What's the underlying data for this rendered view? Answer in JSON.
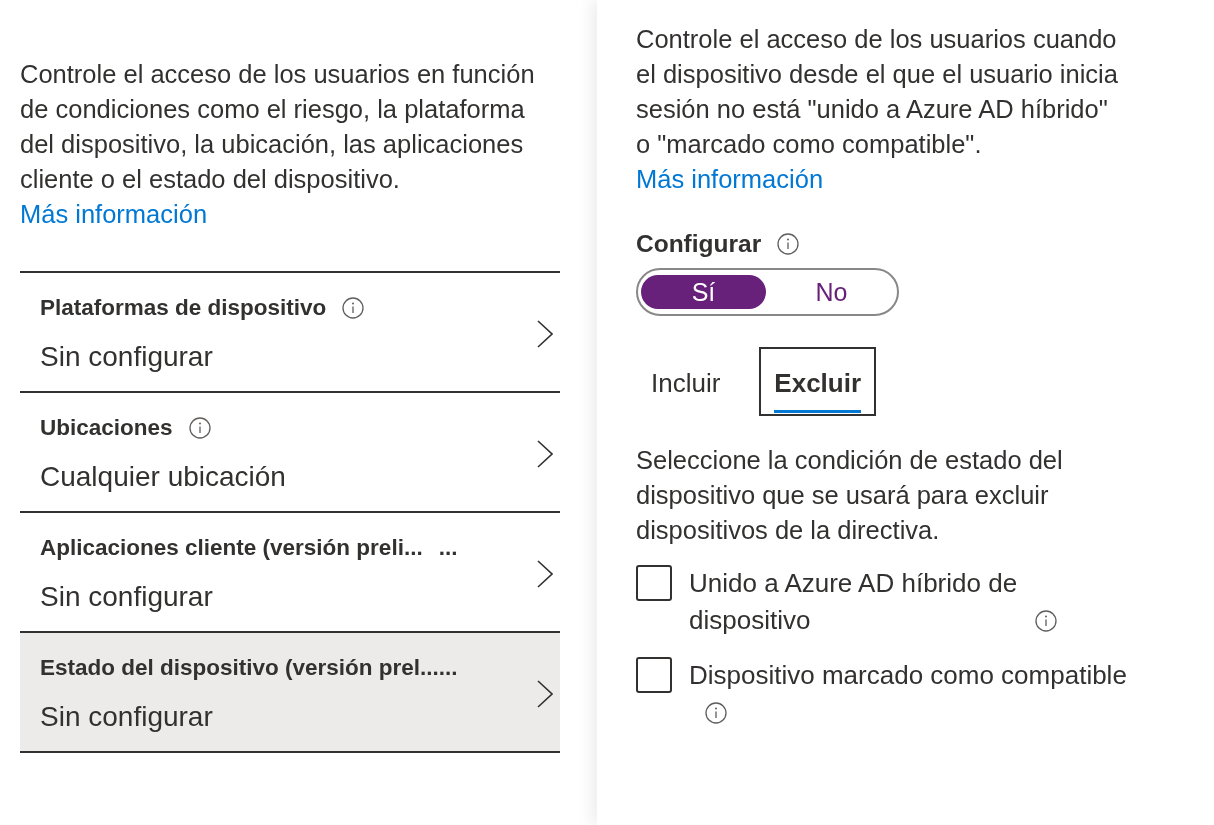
{
  "left_panel": {
    "description": {
      "text": "Controle el acceso de los usuarios en función de condiciones como el riesgo, la plataforma del dispositivo, la ubicación, las aplicaciones cliente o el estado del dispositivo.",
      "link": "Más información"
    },
    "conditions": [
      {
        "title": "Plataformas de dispositivo",
        "info": true,
        "value": "Sin configurar",
        "selected": false
      },
      {
        "title": "Ubicaciones",
        "info": true,
        "value": "Cualquier ubicación",
        "selected": false
      },
      {
        "title": "Aplicaciones cliente (versión preli...",
        "more": "...",
        "info": false,
        "value": "Sin configurar",
        "selected": false
      },
      {
        "title": "Estado del dispositivo (versión prel......",
        "info": false,
        "value": "Sin configurar",
        "selected": true
      }
    ]
  },
  "right_panel": {
    "description": {
      "text": "Controle el acceso de los usuarios cuando el dispositivo desde el que el usuario inicia sesión no está \"unido a Azure AD híbrido\" o \"marcado como compatible\".",
      "link": "Más información"
    },
    "configure": {
      "label": "Configurar",
      "info": true,
      "options": [
        {
          "label": "Sí",
          "selected": true
        },
        {
          "label": "No",
          "selected": false
        }
      ]
    },
    "tabs": [
      {
        "label": "Incluir",
        "selected": false
      },
      {
        "label": "Excluir",
        "selected": true
      }
    ],
    "instructions": "Seleccione la condición de estado del dispositivo que se usará para excluir dispositivos de la directiva.",
    "checkboxes": [
      {
        "label": "Unido a Azure AD híbrido de dispositivo",
        "info": true,
        "checked": false
      },
      {
        "label": "Dispositivo marcado como compatible",
        "info": true,
        "checked": false
      }
    ]
  }
}
